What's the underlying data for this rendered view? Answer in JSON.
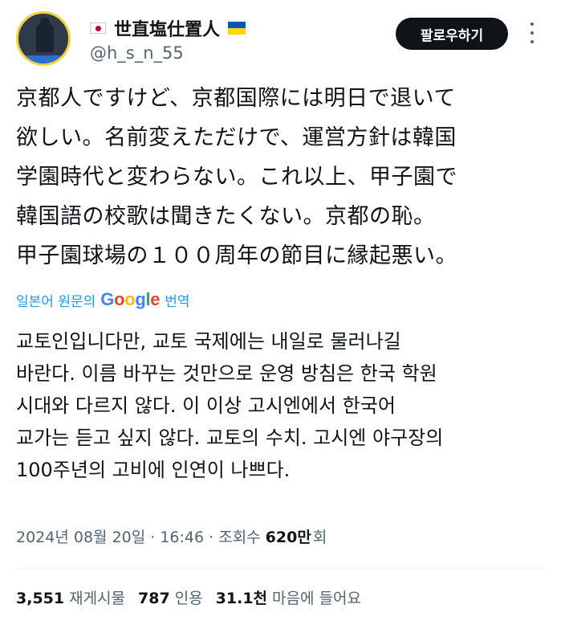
{
  "author": {
    "display_name": "世直塩仕置人",
    "handle": "@h_s_n_55",
    "avatar_icon": "avatar-photo",
    "flag_left": "japan-flag",
    "flag_right": "ukraine-flag"
  },
  "follow_button_label": "팔로우하기",
  "tweet_lines": [
    "京都人ですけど、京都国際には明日で退いて",
    "欲しい。名前変えただけで、運営方針は韓国",
    "学園時代と変わらない。これ以上、甲子園で",
    "韓国語の校歌は聞きたくない。京都の恥。",
    "甲子園球場の１００周年の節目に縁起悪い。"
  ],
  "translation": {
    "prefix": "일본어 원문의",
    "brand": "Google",
    "suffix": "번역"
  },
  "translated_lines": [
    "교토인입니다만, 교토 국제에는 내일로 물러나길",
    "바란다. 이름 바꾸는 것만으로 운영 방침은 한국 학원",
    "시대와 다르지 않다. 이 이상 고시엔에서 한국어",
    "교가는 듣고 싶지 않다. 교토의 수치. 고시엔 야구장의",
    "100주년의 고비에 인연이 나쁘다."
  ],
  "meta": {
    "datetime": "2024년 08월 20일 · 16:46 · 조회수",
    "views": "620만",
    "views_suffix": "회"
  },
  "stats": [
    {
      "num": "3,551",
      "label": "재게시물"
    },
    {
      "num": "787",
      "label": "인용"
    },
    {
      "num": "31.1천",
      "label": "마음에 들어요"
    }
  ],
  "colors": {
    "accent": "#1d9bf0",
    "text": "#0f1419",
    "muted": "#536471",
    "button_bg": "#0f1419"
  }
}
